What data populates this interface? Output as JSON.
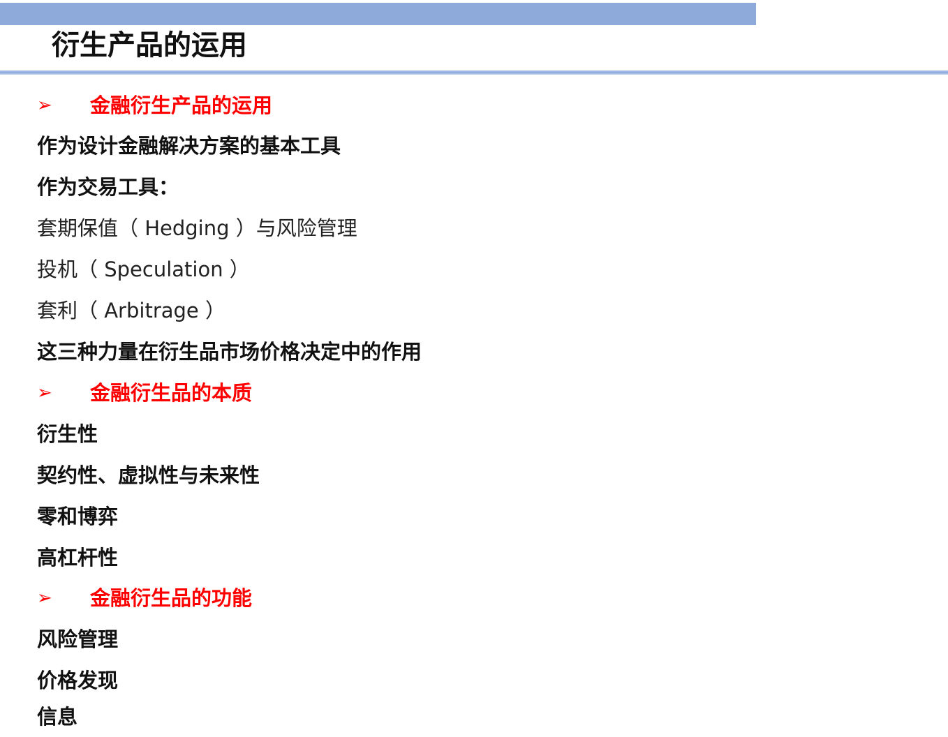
{
  "slide": {
    "title": "衍生产品的运用"
  },
  "sections": [
    {
      "heading": "金融衍生产品的运用",
      "items": [
        {
          "text": "作为设计金融解决方案的基本工具",
          "bold": true
        },
        {
          "text": "作为交易工具：",
          "bold": true
        },
        {
          "text": "套期保值（ Hedging ）与风险管理",
          "bold": false
        },
        {
          "text": "投机（ Speculation ）",
          "bold": false
        },
        {
          "text": "套利（ Arbitrage ）",
          "bold": false
        },
        {
          "text": "这三种力量在衍生品市场价格决定中的作用",
          "bold": true
        }
      ]
    },
    {
      "heading": "金融衍生品的本质",
      "items": [
        {
          "text": "衍生性",
          "bold": true
        },
        {
          "text": "契约性、虚拟性与未来性",
          "bold": true
        },
        {
          "text": "零和博弈",
          "bold": true
        },
        {
          "text": "高杠杆性",
          "bold": true
        }
      ]
    },
    {
      "heading": "金融衍生品的功能",
      "items": [
        {
          "text": "风险管理",
          "bold": true
        },
        {
          "text": "价格发现",
          "bold": true
        },
        {
          "text": "信息",
          "bold": true
        }
      ]
    }
  ],
  "icons": {
    "bullet": "➢",
    "bullet_icon_name": "arrowhead-bullet-icon"
  },
  "colors": {
    "heading_red": "#ff0000",
    "band_blue": "#8eaadb"
  }
}
